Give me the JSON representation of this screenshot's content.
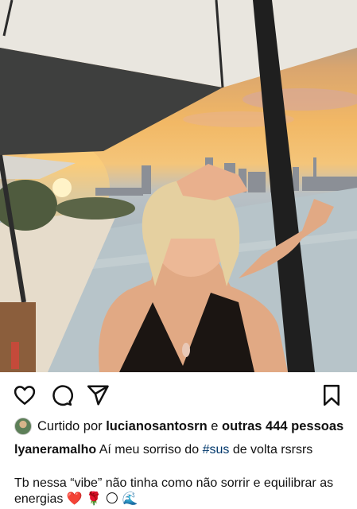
{
  "post": {
    "photo_description_icon": "photo",
    "actions": {
      "like_icon": "heart-icon",
      "comment_icon": "comment-icon",
      "share_icon": "send-icon",
      "save_icon": "bookmark-icon"
    },
    "likes": {
      "prefix": "Curtido por",
      "user": "lucianosantosrn",
      "connector": "e",
      "others": "outras 444 pessoas"
    },
    "caption": {
      "username": "lyaneramalho",
      "text_before": "Aí meu sorriso do",
      "hashtag": "#sus",
      "text_after": "de volta rsrsrs",
      "line2": "Tb nessa “vibe” não tinha como não sorrir e equilibrar as energias ❤️ 🌹 🌕 🌊"
    }
  },
  "colors": {
    "hashtag": "#00376b",
    "text": "#111111"
  }
}
